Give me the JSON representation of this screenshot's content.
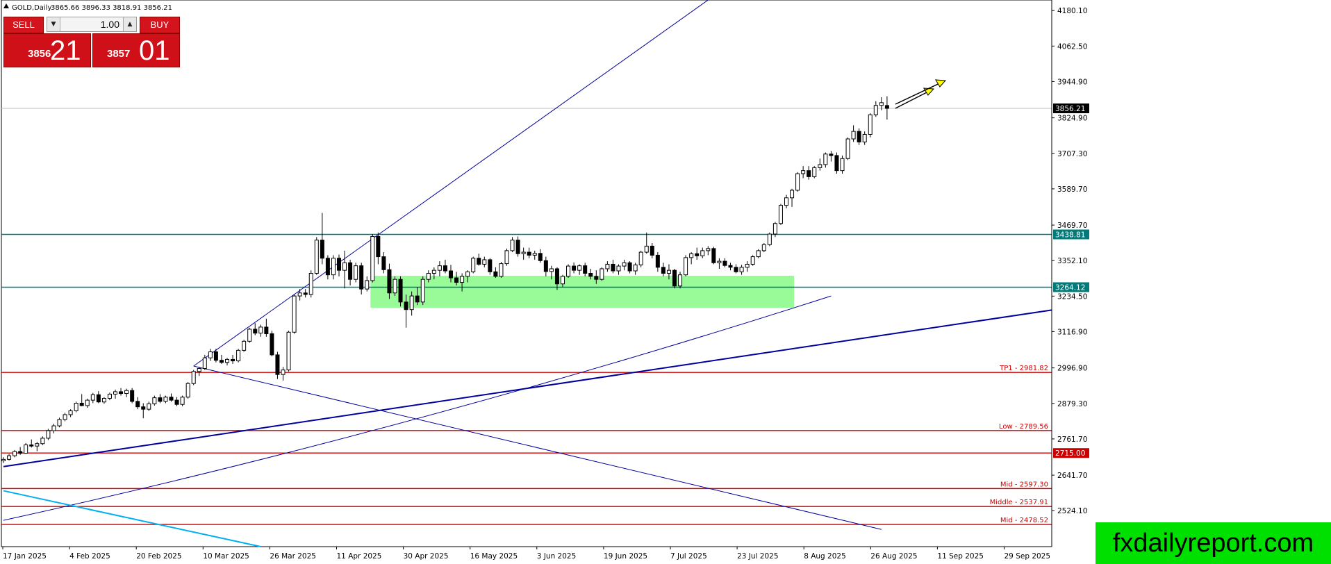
{
  "header": {
    "symbol_label": "GOLD,Daily",
    "ohlc": "3865.66 3896.33 3818.91 3856.21"
  },
  "trade_panel": {
    "sell_label": "SELL",
    "buy_label": "BUY",
    "lot_value": "1.00",
    "bid_prefix": "3856",
    "bid_big": "21",
    "ask_prefix": "3857",
    "ask_big": "01"
  },
  "brand": {
    "text": "fxdailyreport.com"
  },
  "colors": {
    "bull_candle": "#ffffff",
    "bear_candle": "#000000",
    "zone_fill": "#98fb98",
    "resistance_line": "#007b7b",
    "level_line": "#cc0000",
    "trendline": "#00009c",
    "price_line": "#c0c0c0",
    "arrow": "#ffff00",
    "brand_bg": "#00e000"
  },
  "chart_data": {
    "type": "candlestick",
    "symbol": "GOLD",
    "timeframe": "Daily",
    "ylim": [
      2405,
      4215
    ],
    "y_ticks": [
      "4180.10",
      "4062.50",
      "3944.90",
      "3824.90",
      "3707.30",
      "3589.70",
      "3469.70",
      "3352.10",
      "3234.50",
      "3116.90",
      "2996.90",
      "2879.30",
      "2761.70",
      "2641.70",
      "2524.10"
    ],
    "x_ticks": [
      "17 Jan 2025",
      "4 Feb 2025",
      "20 Feb 2025",
      "10 Mar 2025",
      "26 Mar 2025",
      "11 Apr 2025",
      "30 Apr 2025",
      "16 May 2025",
      "3 Jun 2025",
      "19 Jun 2025",
      "7 Jul 2025",
      "23 Jul 2025",
      "8 Aug 2025",
      "26 Aug 2025",
      "11 Sep 2025",
      "29 Sep 2025"
    ],
    "current_price": "3856.21",
    "price_tags": [
      {
        "value": 3856.21,
        "label": "3856.21",
        "style": "current"
      },
      {
        "value": 3438.81,
        "label": "3438.81",
        "style": "resistance"
      },
      {
        "value": 3264.12,
        "label": "3264.12",
        "style": "resistance"
      },
      {
        "value": 2715.0,
        "label": "2715.00",
        "style": "level"
      }
    ],
    "levels": [
      {
        "value": 2981.82,
        "label": "TP1 - 2981.82"
      },
      {
        "value": 2789.56,
        "label": "Low - 2789.56"
      },
      {
        "value": 2715.0,
        "label": ""
      },
      {
        "value": 2597.3,
        "label": "Mid - 2597.30"
      },
      {
        "value": 2537.91,
        "label": "Middle - 2537.91"
      },
      {
        "value": 2478.52,
        "label": "Mid - 2478.52"
      }
    ],
    "resistance_lines": [
      3438.81,
      3264.12
    ],
    "zone": {
      "from_index": 66,
      "to_index": 141,
      "price_low": 3196,
      "price_high": 3302
    },
    "trendlines": [
      {
        "p1": [
          34,
          3003
        ],
        "p2": [
          126,
          4215
        ],
        "weight": 1
      },
      {
        "p1": [
          34,
          3003
        ],
        "p2": [
          157,
          2462
        ],
        "weight": 1
      },
      {
        "p1": [
          0,
          2670
        ],
        "p2": [
          188,
          3190
        ],
        "weight": 2
      },
      {
        "p1": [
          0,
          2492
        ],
        "p2": [
          148,
          3235
        ],
        "weight": 1,
        "curve": true
      },
      {
        "p1": [
          0,
          2590
        ],
        "p2": [
          46,
          2405
        ],
        "weight": 2,
        "color": "#00b0f0"
      }
    ],
    "candles": [
      [
        2689,
        2701,
        2682,
        2694
      ],
      [
        2694,
        2712,
        2690,
        2706
      ],
      [
        2706,
        2725,
        2701,
        2720
      ],
      [
        2720,
        2735,
        2709,
        2714
      ],
      [
        2714,
        2748,
        2712,
        2742
      ],
      [
        2742,
        2760,
        2733,
        2738
      ],
      [
        2738,
        2752,
        2721,
        2746
      ],
      [
        2746,
        2770,
        2741,
        2764
      ],
      [
        2764,
        2795,
        2758,
        2789
      ],
      [
        2789,
        2812,
        2780,
        2805
      ],
      [
        2805,
        2832,
        2800,
        2826
      ],
      [
        2826,
        2848,
        2820,
        2842
      ],
      [
        2842,
        2860,
        2834,
        2855
      ],
      [
        2855,
        2885,
        2850,
        2880
      ],
      [
        2880,
        2910,
        2870,
        2872
      ],
      [
        2872,
        2895,
        2865,
        2890
      ],
      [
        2890,
        2914,
        2880,
        2908
      ],
      [
        2908,
        2920,
        2880,
        2884
      ],
      [
        2884,
        2900,
        2878,
        2896
      ],
      [
        2896,
        2915,
        2890,
        2910
      ],
      [
        2910,
        2925,
        2895,
        2918
      ],
      [
        2918,
        2930,
        2905,
        2912
      ],
      [
        2912,
        2928,
        2900,
        2922
      ],
      [
        2922,
        2930,
        2880,
        2886
      ],
      [
        2886,
        2900,
        2860,
        2868
      ],
      [
        2868,
        2880,
        2830,
        2860
      ],
      [
        2860,
        2885,
        2854,
        2878
      ],
      [
        2878,
        2905,
        2872,
        2898
      ],
      [
        2898,
        2910,
        2880,
        2886
      ],
      [
        2886,
        2905,
        2880,
        2900
      ],
      [
        2900,
        2912,
        2885,
        2890
      ],
      [
        2890,
        2900,
        2870,
        2876
      ],
      [
        2876,
        2905,
        2870,
        2900
      ],
      [
        2900,
        2950,
        2895,
        2945
      ],
      [
        2945,
        2990,
        2940,
        2985
      ],
      [
        2985,
        3000,
        2970,
        2995
      ],
      [
        2995,
        3040,
        2990,
        3030
      ],
      [
        3030,
        3060,
        3020,
        3050
      ],
      [
        3050,
        3060,
        3015,
        3022
      ],
      [
        3022,
        3040,
        3010,
        3015
      ],
      [
        3015,
        3030,
        3005,
        3025
      ],
      [
        3025,
        3040,
        3010,
        3020
      ],
      [
        3020,
        3060,
        3015,
        3055
      ],
      [
        3055,
        3090,
        3050,
        3085
      ],
      [
        3085,
        3130,
        3080,
        3125
      ],
      [
        3125,
        3145,
        3105,
        3112
      ],
      [
        3112,
        3140,
        3100,
        3132
      ],
      [
        3132,
        3160,
        3100,
        3110
      ],
      [
        3110,
        3120,
        3035,
        3040
      ],
      [
        3040,
        3050,
        2960,
        2975
      ],
      [
        2975,
        3000,
        2955,
        2990
      ],
      [
        2990,
        3120,
        2985,
        3115
      ],
      [
        3115,
        3240,
        3110,
        3235
      ],
      [
        3235,
        3258,
        3220,
        3245
      ],
      [
        3245,
        3258,
        3230,
        3240
      ],
      [
        3240,
        3320,
        3230,
        3310
      ],
      [
        3310,
        3430,
        3305,
        3420
      ],
      [
        3420,
        3510,
        3340,
        3360
      ],
      [
        3360,
        3370,
        3290,
        3305
      ],
      [
        3305,
        3370,
        3290,
        3360
      ],
      [
        3360,
        3372,
        3300,
        3320
      ],
      [
        3320,
        3385,
        3260,
        3345
      ],
      [
        3345,
        3355,
        3270,
        3290
      ],
      [
        3290,
        3345,
        3280,
        3335
      ],
      [
        3335,
        3345,
        3240,
        3258
      ],
      [
        3258,
        3300,
        3250,
        3286
      ],
      [
        3286,
        3440,
        3280,
        3432
      ],
      [
        3432,
        3445,
        3340,
        3365
      ],
      [
        3365,
        3380,
        3310,
        3322
      ],
      [
        3322,
        3342,
        3225,
        3245
      ],
      [
        3245,
        3300,
        3235,
        3290
      ],
      [
        3290,
        3300,
        3200,
        3215
      ],
      [
        3215,
        3240,
        3130,
        3190
      ],
      [
        3190,
        3250,
        3170,
        3235
      ],
      [
        3235,
        3265,
        3205,
        3215
      ],
      [
        3215,
        3300,
        3205,
        3290
      ],
      [
        3290,
        3320,
        3280,
        3310
      ],
      [
        3310,
        3330,
        3290,
        3320
      ],
      [
        3320,
        3350,
        3300,
        3335
      ],
      [
        3335,
        3355,
        3310,
        3318
      ],
      [
        3318,
        3338,
        3280,
        3295
      ],
      [
        3295,
        3315,
        3270,
        3280
      ],
      [
        3280,
        3310,
        3250,
        3300
      ],
      [
        3300,
        3320,
        3280,
        3315
      ],
      [
        3315,
        3365,
        3310,
        3360
      ],
      [
        3360,
        3375,
        3335,
        3340
      ],
      [
        3340,
        3365,
        3330,
        3355
      ],
      [
        3355,
        3360,
        3305,
        3315
      ],
      [
        3315,
        3330,
        3295,
        3300
      ],
      [
        3300,
        3348,
        3295,
        3342
      ],
      [
        3342,
        3392,
        3335,
        3385
      ],
      [
        3385,
        3430,
        3380,
        3420
      ],
      [
        3420,
        3432,
        3365,
        3375
      ],
      [
        3375,
        3395,
        3355,
        3380
      ],
      [
        3380,
        3395,
        3360,
        3370
      ],
      [
        3370,
        3385,
        3355,
        3376
      ],
      [
        3376,
        3390,
        3345,
        3352
      ],
      [
        3352,
        3365,
        3300,
        3316
      ],
      [
        3316,
        3335,
        3290,
        3325
      ],
      [
        3325,
        3330,
        3255,
        3275
      ],
      [
        3275,
        3305,
        3265,
        3300
      ],
      [
        3300,
        3340,
        3295,
        3334
      ],
      [
        3334,
        3346,
        3310,
        3320
      ],
      [
        3320,
        3340,
        3305,
        3335
      ],
      [
        3335,
        3345,
        3300,
        3310
      ],
      [
        3310,
        3325,
        3290,
        3300
      ],
      [
        3300,
        3320,
        3275,
        3290
      ],
      [
        3290,
        3330,
        3285,
        3325
      ],
      [
        3325,
        3350,
        3315,
        3340
      ],
      [
        3340,
        3355,
        3310,
        3318
      ],
      [
        3318,
        3340,
        3305,
        3334
      ],
      [
        3334,
        3355,
        3320,
        3345
      ],
      [
        3345,
        3350,
        3310,
        3318
      ],
      [
        3318,
        3345,
        3305,
        3338
      ],
      [
        3338,
        3385,
        3330,
        3380
      ],
      [
        3380,
        3445,
        3375,
        3400
      ],
      [
        3400,
        3410,
        3360,
        3370
      ],
      [
        3370,
        3380,
        3315,
        3330
      ],
      [
        3330,
        3345,
        3300,
        3310
      ],
      [
        3310,
        3340,
        3290,
        3320
      ],
      [
        3320,
        3325,
        3260,
        3268
      ],
      [
        3268,
        3315,
        3260,
        3305
      ],
      [
        3305,
        3370,
        3300,
        3362
      ],
      [
        3362,
        3380,
        3340,
        3375
      ],
      [
        3375,
        3395,
        3355,
        3368
      ],
      [
        3368,
        3395,
        3360,
        3385
      ],
      [
        3385,
        3400,
        3370,
        3392
      ],
      [
        3392,
        3398,
        3340,
        3345
      ],
      [
        3345,
        3360,
        3325,
        3350
      ],
      [
        3350,
        3360,
        3330,
        3336
      ],
      [
        3336,
        3345,
        3320,
        3330
      ],
      [
        3330,
        3340,
        3310,
        3315
      ],
      [
        3315,
        3338,
        3305,
        3330
      ],
      [
        3330,
        3350,
        3315,
        3340
      ],
      [
        3340,
        3370,
        3335,
        3365
      ],
      [
        3365,
        3390,
        3360,
        3385
      ],
      [
        3385,
        3410,
        3380,
        3405
      ],
      [
        3405,
        3445,
        3400,
        3440
      ],
      [
        3440,
        3480,
        3430,
        3475
      ],
      [
        3475,
        3540,
        3470,
        3535
      ],
      [
        3535,
        3570,
        3525,
        3560
      ],
      [
        3560,
        3590,
        3530,
        3585
      ],
      [
        3585,
        3645,
        3580,
        3640
      ],
      [
        3640,
        3665,
        3625,
        3650
      ],
      [
        3650,
        3665,
        3620,
        3630
      ],
      [
        3630,
        3665,
        3625,
        3660
      ],
      [
        3660,
        3690,
        3650,
        3670
      ],
      [
        3670,
        3710,
        3660,
        3705
      ],
      [
        3705,
        3715,
        3680,
        3700
      ],
      [
        3700,
        3710,
        3640,
        3650
      ],
      [
        3650,
        3700,
        3640,
        3690
      ],
      [
        3690,
        3760,
        3685,
        3755
      ],
      [
        3755,
        3800,
        3745,
        3780
      ],
      [
        3780,
        3790,
        3735,
        3745
      ],
      [
        3745,
        3780,
        3735,
        3770
      ],
      [
        3770,
        3840,
        3760,
        3835
      ],
      [
        3835,
        3880,
        3828,
        3866
      ],
      [
        3866,
        3893,
        3850,
        3875
      ],
      [
        3865.66,
        3896.33,
        3818.91,
        3856.21
      ]
    ]
  }
}
